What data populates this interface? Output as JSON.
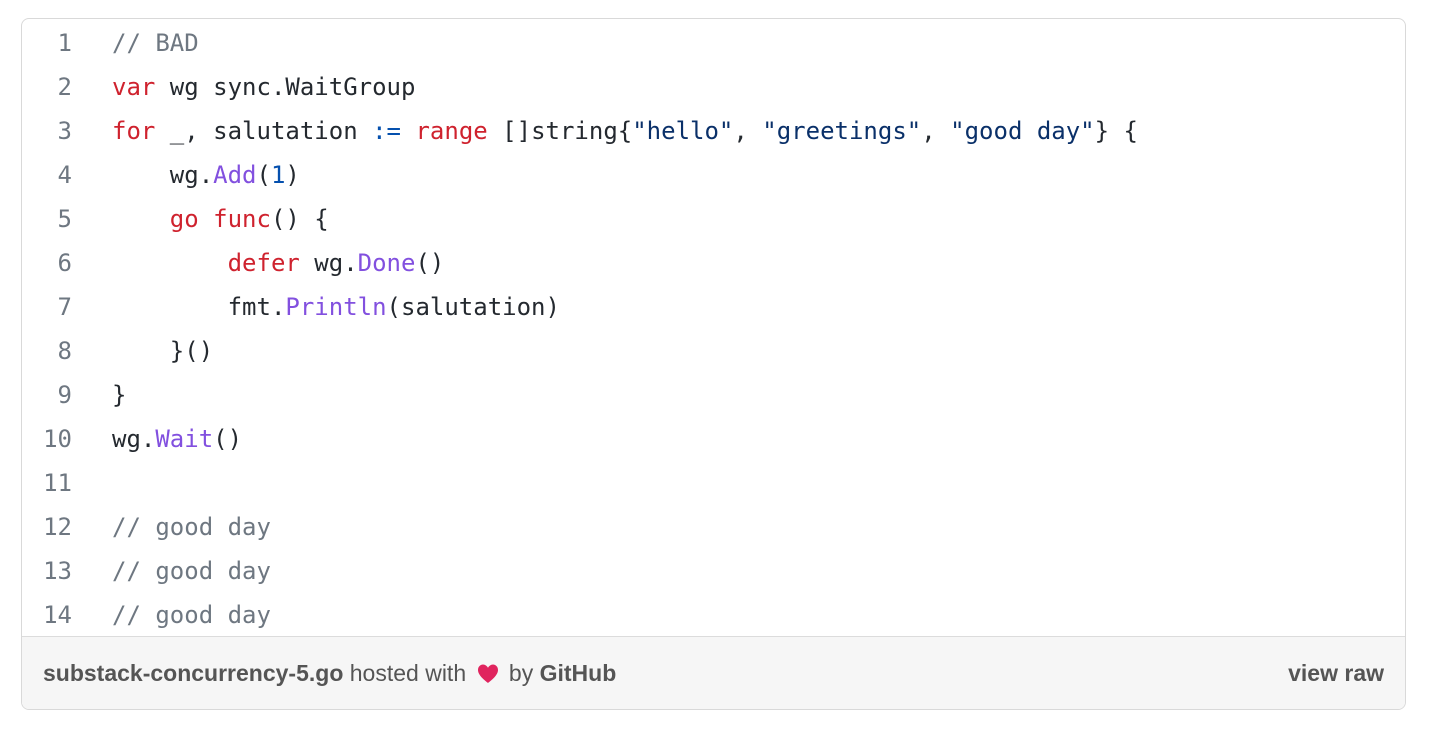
{
  "code": {
    "lines": [
      {
        "num": "1",
        "tokens": [
          {
            "t": "// BAD",
            "c": "c"
          }
        ]
      },
      {
        "num": "2",
        "tokens": [
          {
            "t": "var",
            "c": "k"
          },
          {
            "t": " wg sync.WaitGroup",
            "c": ""
          }
        ]
      },
      {
        "num": "3",
        "tokens": [
          {
            "t": "for",
            "c": "k"
          },
          {
            "t": " _, salutation ",
            "c": ""
          },
          {
            "t": ":=",
            "c": "n"
          },
          {
            "t": " ",
            "c": ""
          },
          {
            "t": "range",
            "c": "k"
          },
          {
            "t": " []string{",
            "c": ""
          },
          {
            "t": "\"hello\"",
            "c": "s"
          },
          {
            "t": ", ",
            "c": ""
          },
          {
            "t": "\"greetings\"",
            "c": "s"
          },
          {
            "t": ", ",
            "c": ""
          },
          {
            "t": "\"good day\"",
            "c": "s"
          },
          {
            "t": "} {",
            "c": ""
          }
        ]
      },
      {
        "num": "4",
        "tokens": [
          {
            "t": "    wg.",
            "c": ""
          },
          {
            "t": "Add",
            "c": "f"
          },
          {
            "t": "(",
            "c": ""
          },
          {
            "t": "1",
            "c": "n"
          },
          {
            "t": ")",
            "c": ""
          }
        ]
      },
      {
        "num": "5",
        "tokens": [
          {
            "t": "    ",
            "c": ""
          },
          {
            "t": "go",
            "c": "k"
          },
          {
            "t": " ",
            "c": ""
          },
          {
            "t": "func",
            "c": "k"
          },
          {
            "t": "() {",
            "c": ""
          }
        ]
      },
      {
        "num": "6",
        "tokens": [
          {
            "t": "        ",
            "c": ""
          },
          {
            "t": "defer",
            "c": "k"
          },
          {
            "t": " wg.",
            "c": ""
          },
          {
            "t": "Done",
            "c": "f"
          },
          {
            "t": "()",
            "c": ""
          }
        ]
      },
      {
        "num": "7",
        "tokens": [
          {
            "t": "        fmt.",
            "c": ""
          },
          {
            "t": "Println",
            "c": "f"
          },
          {
            "t": "(salutation)",
            "c": ""
          }
        ]
      },
      {
        "num": "8",
        "tokens": [
          {
            "t": "    }()",
            "c": ""
          }
        ]
      },
      {
        "num": "9",
        "tokens": [
          {
            "t": "}",
            "c": ""
          }
        ]
      },
      {
        "num": "10",
        "tokens": [
          {
            "t": "wg.",
            "c": ""
          },
          {
            "t": "Wait",
            "c": "f"
          },
          {
            "t": "()",
            "c": ""
          }
        ]
      },
      {
        "num": "11",
        "tokens": []
      },
      {
        "num": "12",
        "tokens": [
          {
            "t": "// good day",
            "c": "c"
          }
        ]
      },
      {
        "num": "13",
        "tokens": [
          {
            "t": "// good day",
            "c": "c"
          }
        ]
      },
      {
        "num": "14",
        "tokens": [
          {
            "t": "// good day",
            "c": "c"
          }
        ]
      }
    ]
  },
  "footer": {
    "filename": "substack-concurrency-5.go",
    "hosted_text": " hosted with ",
    "heart_icon": "heart-icon",
    "by_text": " by ",
    "github": "GitHub",
    "view_raw": "view raw"
  },
  "colors": {
    "keyword": "#cf222e",
    "string": "#0a3069",
    "function": "#8250df",
    "number": "#0550ae",
    "comment": "#6e7781",
    "text": "#24292f",
    "heart": "#e0245e"
  }
}
